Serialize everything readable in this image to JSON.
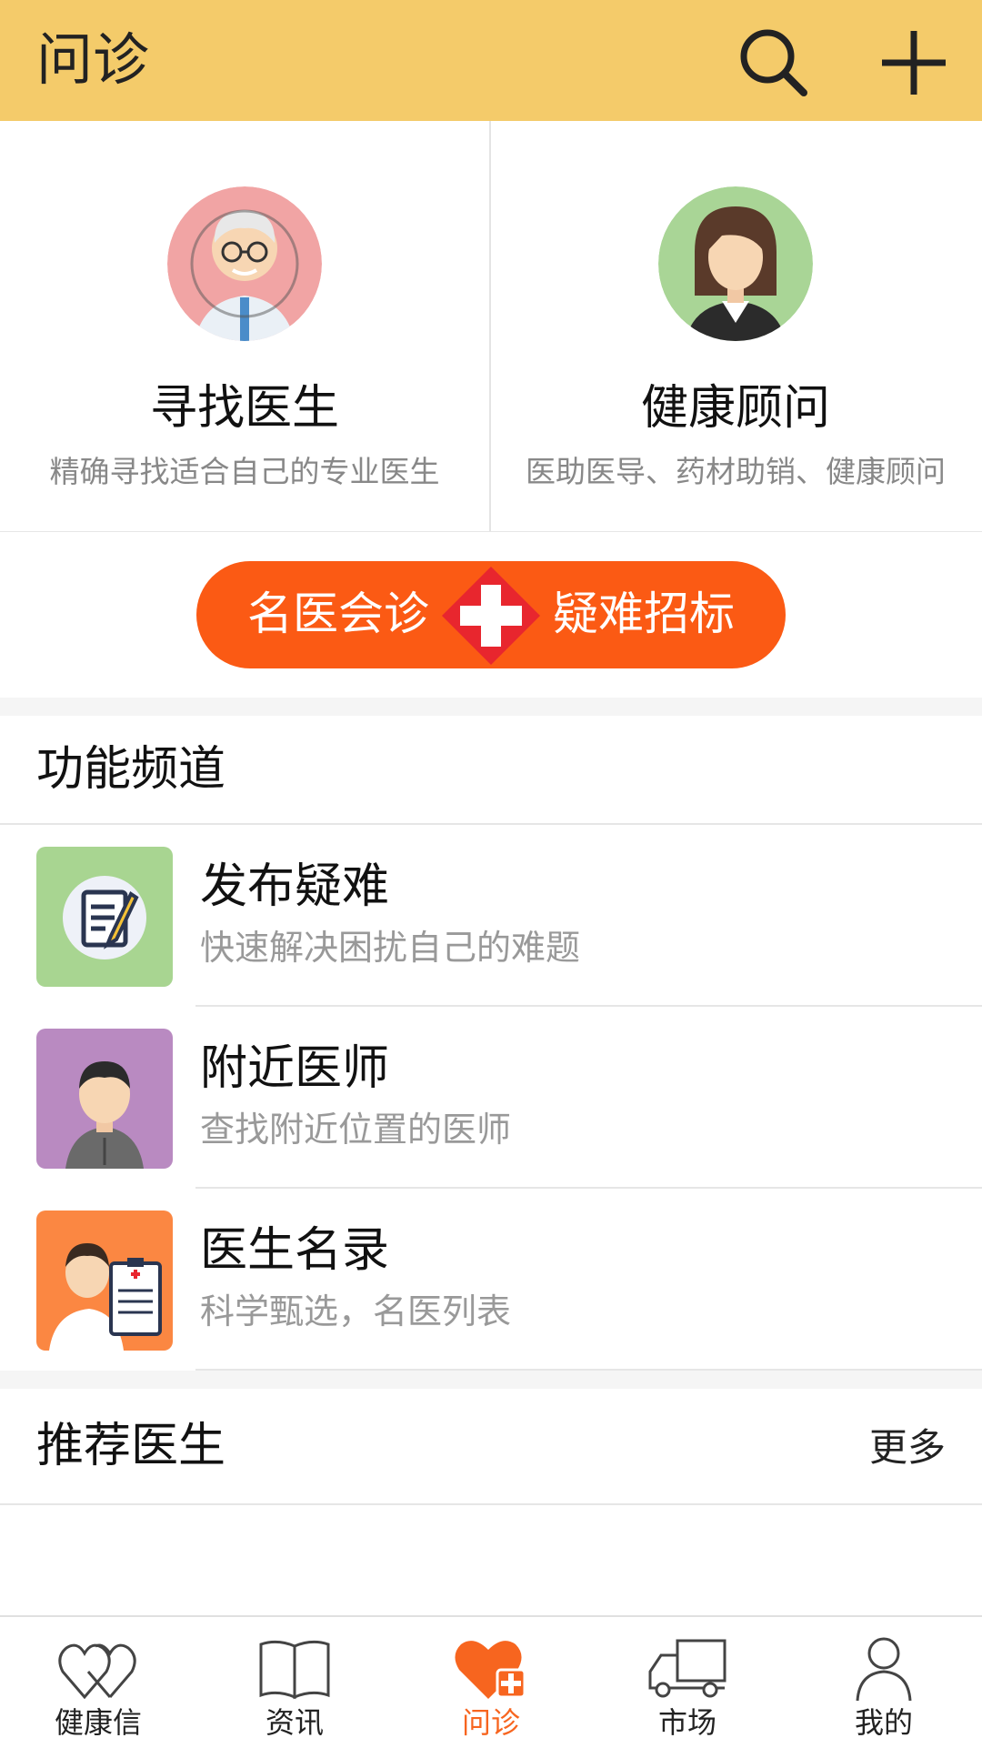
{
  "header": {
    "title": "问诊",
    "search_icon": "search-icon",
    "add_icon": "plus-icon"
  },
  "entry_cards": [
    {
      "name": "寻找医生",
      "desc": "精确寻找适合自己的专业医生"
    },
    {
      "name": "健康顾问",
      "desc": "医助医导、药材助销、健康顾问"
    }
  ],
  "banner": {
    "left": "名医会诊",
    "right": "疑难招标",
    "icon": "medical-cross-icon"
  },
  "functions": {
    "title": "功能频道",
    "items": [
      {
        "title": "发布疑难",
        "subtitle": "快速解决困扰自己的难题"
      },
      {
        "title": "附近医师",
        "subtitle": "查找附近位置的医师"
      },
      {
        "title": "医生名录",
        "subtitle": "科学甄选，名医列表"
      }
    ]
  },
  "recommend": {
    "title": "推荐医生",
    "more": "更多"
  },
  "tabbar": {
    "items": [
      {
        "label": "健康信",
        "icon": "hearts-icon"
      },
      {
        "label": "资讯",
        "icon": "book-icon"
      },
      {
        "label": "问诊",
        "icon": "heart-plus-icon"
      },
      {
        "label": "市场",
        "icon": "truck-icon"
      },
      {
        "label": "我的",
        "icon": "user-icon"
      }
    ],
    "active": "问诊"
  },
  "colors": {
    "header_bg": "#f4cb6a",
    "accent": "#fb5a14",
    "active_tab": "#f7651f"
  }
}
